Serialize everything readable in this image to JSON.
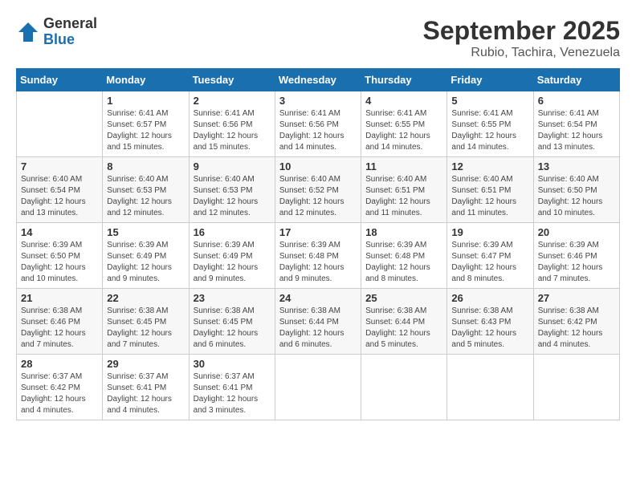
{
  "logo": {
    "general": "General",
    "blue": "Blue"
  },
  "header": {
    "month": "September 2025",
    "location": "Rubio, Tachira, Venezuela"
  },
  "days_of_week": [
    "Sunday",
    "Monday",
    "Tuesday",
    "Wednesday",
    "Thursday",
    "Friday",
    "Saturday"
  ],
  "weeks": [
    [
      {
        "day": "",
        "info": ""
      },
      {
        "day": "1",
        "info": "Sunrise: 6:41 AM\nSunset: 6:57 PM\nDaylight: 12 hours\nand 15 minutes."
      },
      {
        "day": "2",
        "info": "Sunrise: 6:41 AM\nSunset: 6:56 PM\nDaylight: 12 hours\nand 15 minutes."
      },
      {
        "day": "3",
        "info": "Sunrise: 6:41 AM\nSunset: 6:56 PM\nDaylight: 12 hours\nand 14 minutes."
      },
      {
        "day": "4",
        "info": "Sunrise: 6:41 AM\nSunset: 6:55 PM\nDaylight: 12 hours\nand 14 minutes."
      },
      {
        "day": "5",
        "info": "Sunrise: 6:41 AM\nSunset: 6:55 PM\nDaylight: 12 hours\nand 14 minutes."
      },
      {
        "day": "6",
        "info": "Sunrise: 6:41 AM\nSunset: 6:54 PM\nDaylight: 12 hours\nand 13 minutes."
      }
    ],
    [
      {
        "day": "7",
        "info": "Sunrise: 6:40 AM\nSunset: 6:54 PM\nDaylight: 12 hours\nand 13 minutes."
      },
      {
        "day": "8",
        "info": "Sunrise: 6:40 AM\nSunset: 6:53 PM\nDaylight: 12 hours\nand 12 minutes."
      },
      {
        "day": "9",
        "info": "Sunrise: 6:40 AM\nSunset: 6:53 PM\nDaylight: 12 hours\nand 12 minutes."
      },
      {
        "day": "10",
        "info": "Sunrise: 6:40 AM\nSunset: 6:52 PM\nDaylight: 12 hours\nand 12 minutes."
      },
      {
        "day": "11",
        "info": "Sunrise: 6:40 AM\nSunset: 6:51 PM\nDaylight: 12 hours\nand 11 minutes."
      },
      {
        "day": "12",
        "info": "Sunrise: 6:40 AM\nSunset: 6:51 PM\nDaylight: 12 hours\nand 11 minutes."
      },
      {
        "day": "13",
        "info": "Sunrise: 6:40 AM\nSunset: 6:50 PM\nDaylight: 12 hours\nand 10 minutes."
      }
    ],
    [
      {
        "day": "14",
        "info": "Sunrise: 6:39 AM\nSunset: 6:50 PM\nDaylight: 12 hours\nand 10 minutes."
      },
      {
        "day": "15",
        "info": "Sunrise: 6:39 AM\nSunset: 6:49 PM\nDaylight: 12 hours\nand 9 minutes."
      },
      {
        "day": "16",
        "info": "Sunrise: 6:39 AM\nSunset: 6:49 PM\nDaylight: 12 hours\nand 9 minutes."
      },
      {
        "day": "17",
        "info": "Sunrise: 6:39 AM\nSunset: 6:48 PM\nDaylight: 12 hours\nand 9 minutes."
      },
      {
        "day": "18",
        "info": "Sunrise: 6:39 AM\nSunset: 6:48 PM\nDaylight: 12 hours\nand 8 minutes."
      },
      {
        "day": "19",
        "info": "Sunrise: 6:39 AM\nSunset: 6:47 PM\nDaylight: 12 hours\nand 8 minutes."
      },
      {
        "day": "20",
        "info": "Sunrise: 6:39 AM\nSunset: 6:46 PM\nDaylight: 12 hours\nand 7 minutes."
      }
    ],
    [
      {
        "day": "21",
        "info": "Sunrise: 6:38 AM\nSunset: 6:46 PM\nDaylight: 12 hours\nand 7 minutes."
      },
      {
        "day": "22",
        "info": "Sunrise: 6:38 AM\nSunset: 6:45 PM\nDaylight: 12 hours\nand 7 minutes."
      },
      {
        "day": "23",
        "info": "Sunrise: 6:38 AM\nSunset: 6:45 PM\nDaylight: 12 hours\nand 6 minutes."
      },
      {
        "day": "24",
        "info": "Sunrise: 6:38 AM\nSunset: 6:44 PM\nDaylight: 12 hours\nand 6 minutes."
      },
      {
        "day": "25",
        "info": "Sunrise: 6:38 AM\nSunset: 6:44 PM\nDaylight: 12 hours\nand 5 minutes."
      },
      {
        "day": "26",
        "info": "Sunrise: 6:38 AM\nSunset: 6:43 PM\nDaylight: 12 hours\nand 5 minutes."
      },
      {
        "day": "27",
        "info": "Sunrise: 6:38 AM\nSunset: 6:42 PM\nDaylight: 12 hours\nand 4 minutes."
      }
    ],
    [
      {
        "day": "28",
        "info": "Sunrise: 6:37 AM\nSunset: 6:42 PM\nDaylight: 12 hours\nand 4 minutes."
      },
      {
        "day": "29",
        "info": "Sunrise: 6:37 AM\nSunset: 6:41 PM\nDaylight: 12 hours\nand 4 minutes."
      },
      {
        "day": "30",
        "info": "Sunrise: 6:37 AM\nSunset: 6:41 PM\nDaylight: 12 hours\nand 3 minutes."
      },
      {
        "day": "",
        "info": ""
      },
      {
        "day": "",
        "info": ""
      },
      {
        "day": "",
        "info": ""
      },
      {
        "day": "",
        "info": ""
      }
    ]
  ]
}
